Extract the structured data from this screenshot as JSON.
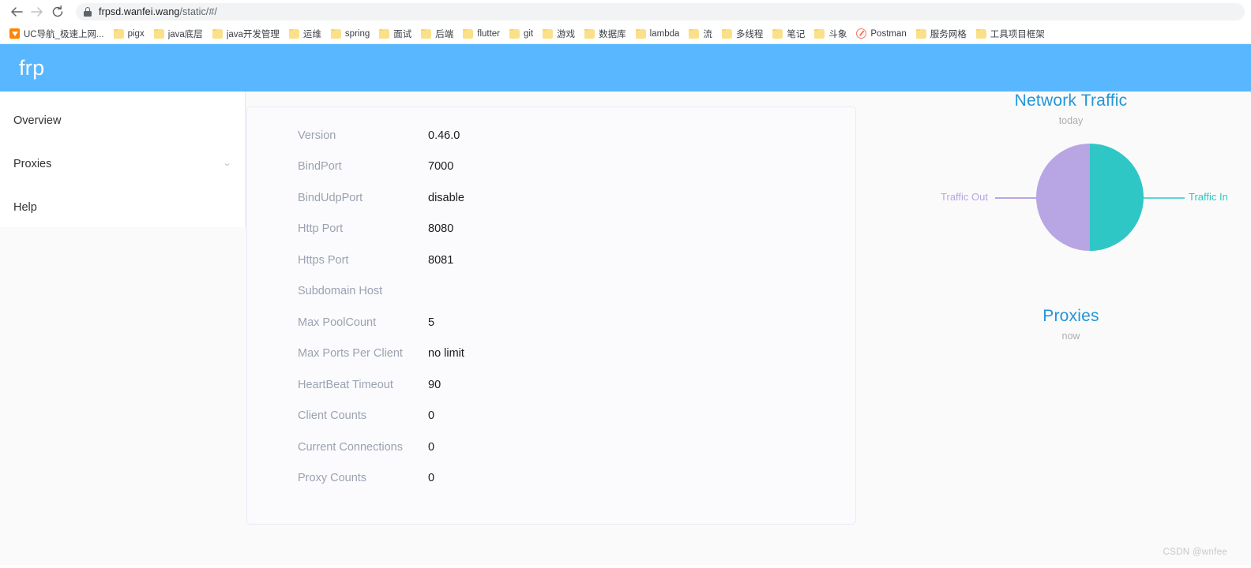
{
  "browser": {
    "nav": {
      "back_label": "←",
      "forward_label": "→",
      "reload_label": "⟳"
    },
    "omnibox": {
      "lock_icon": "lock-icon",
      "url_main": "frpsd.wanfei.wang",
      "url_path": "/static/#/"
    },
    "bookmarks": [
      {
        "label": "UC导航_极速上网...",
        "icon": "uc-navigation-icon"
      },
      {
        "label": "pigx",
        "icon": "folder-icon"
      },
      {
        "label": "java底层",
        "icon": "folder-icon"
      },
      {
        "label": "java开发管理",
        "icon": "folder-icon"
      },
      {
        "label": "运维",
        "icon": "folder-icon"
      },
      {
        "label": "spring",
        "icon": "folder-icon"
      },
      {
        "label": "面试",
        "icon": "folder-icon"
      },
      {
        "label": "后端",
        "icon": "folder-icon"
      },
      {
        "label": "flutter",
        "icon": "folder-icon"
      },
      {
        "label": "git",
        "icon": "folder-icon"
      },
      {
        "label": "游戏",
        "icon": "folder-icon"
      },
      {
        "label": "数据库",
        "icon": "folder-icon"
      },
      {
        "label": "lambda",
        "icon": "folder-icon"
      },
      {
        "label": "流",
        "icon": "folder-icon"
      },
      {
        "label": "多线程",
        "icon": "folder-icon"
      },
      {
        "label": "笔记",
        "icon": "folder-icon"
      },
      {
        "label": "斗象",
        "icon": "folder-icon"
      },
      {
        "label": "Postman",
        "icon": "postman-icon"
      },
      {
        "label": "服务网格",
        "icon": "folder-icon"
      },
      {
        "label": "工具项目框架",
        "icon": "folder-icon"
      }
    ]
  },
  "app": {
    "title": "frp",
    "header_color": "#58b7ff",
    "sidebar": {
      "items": [
        {
          "label": "Overview",
          "expandable": false
        },
        {
          "label": "Proxies",
          "expandable": true,
          "chevron": "⌄"
        },
        {
          "label": "Help",
          "expandable": false
        }
      ]
    },
    "server_info": {
      "rows": [
        {
          "key": "Version",
          "value": "0.46.0"
        },
        {
          "key": "BindPort",
          "value": "7000"
        },
        {
          "key": "BindUdpPort",
          "value": "disable"
        },
        {
          "key": "Http Port",
          "value": "8080"
        },
        {
          "key": "Https Port",
          "value": "8081"
        },
        {
          "key": "Subdomain Host",
          "value": ""
        },
        {
          "key": "Max PoolCount",
          "value": "5"
        },
        {
          "key": "Max Ports Per Client",
          "value": "no limit"
        },
        {
          "key": "HeartBeat Timeout",
          "value": "90"
        },
        {
          "key": "Client Counts",
          "value": "0"
        },
        {
          "key": "Current Connections",
          "value": "0"
        },
        {
          "key": "Proxy Counts",
          "value": "0"
        }
      ]
    }
  },
  "chart_data": [
    {
      "type": "pie",
      "title": "Network Traffic",
      "subtitle": "today",
      "categories": [
        "Traffic Out",
        "Traffic In"
      ],
      "values": [
        50,
        50
      ],
      "colors": [
        "#b8a5e3",
        "#2fc6c6"
      ],
      "legend_position": "outside-labels",
      "xlabel": "",
      "ylabel": ""
    },
    {
      "type": "pie",
      "title": "Proxies",
      "subtitle": "now",
      "categories": [],
      "values": [],
      "colors": [],
      "legend_position": "none",
      "xlabel": "",
      "ylabel": ""
    }
  ],
  "watermark": "CSDN @wnfee"
}
